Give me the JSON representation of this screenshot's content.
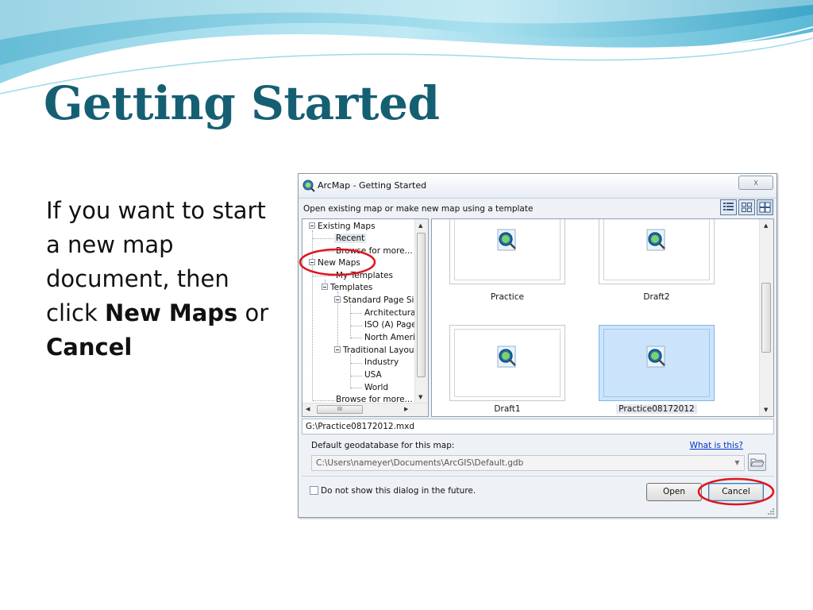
{
  "slide": {
    "title": "Getting Started",
    "body_prefix": "If you want to start a new map document, then click ",
    "body_bold1": "New Maps",
    "body_mid": " or ",
    "body_bold2": "Cancel"
  },
  "dialog": {
    "title": "ArcMap - Getting Started",
    "title_icon": "arcmap-globe-icon",
    "close_label": "☓",
    "subheading": "Open existing map or make new map using a template",
    "view_buttons": [
      "details-view-icon",
      "small-thumbnails-icon",
      "large-thumbnails-icon"
    ],
    "tree": {
      "existing_maps": "Existing Maps",
      "recent": "Recent",
      "browse_existing": "Browse for more...",
      "new_maps": "New Maps",
      "my_templates": "My Templates",
      "templates": "Templates",
      "standard_page": "Standard Page Si",
      "architectural": "Architectural",
      "iso": "ISO (A) Page",
      "north_america": "North Americ",
      "traditional": "Traditional Layou",
      "industry": "Industry",
      "usa": "USA",
      "world": "World",
      "browse_templates": "Browse for more..."
    },
    "thumbnails": [
      {
        "label": "Practice",
        "selected": false
      },
      {
        "label": "Draft2",
        "selected": false
      },
      {
        "label": "Draft1",
        "selected": false
      },
      {
        "label": "Practice08172012",
        "selected": true
      }
    ],
    "scroll_grip": "III",
    "path": "G:\\Practice08172012.mxd",
    "gdb_label": "Default geodatabase for this map:",
    "gdb_link": "What is this?",
    "gdb_value": "C:\\Users\\nameyer\\Documents\\ArcGIS\\Default.gdb",
    "dont_show_label": "Do not show this dialog in the future.",
    "dont_show_checked": false,
    "open_label": "Open",
    "cancel_label": "Cancel"
  },
  "annotations": {
    "circle_color": "#e0141e"
  },
  "colors": {
    "title": "#155f73",
    "selection": "#cce4fb",
    "link": "#0033cc"
  }
}
